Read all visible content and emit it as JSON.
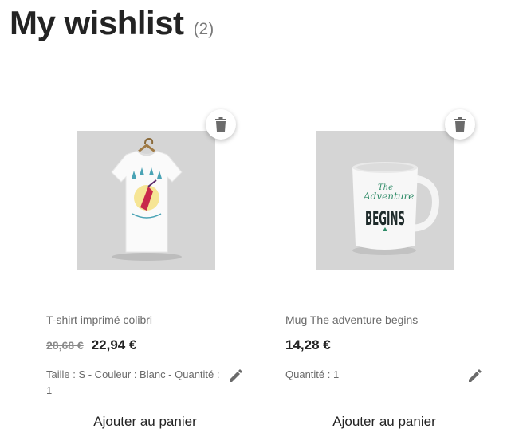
{
  "header": {
    "title": "My wishlist",
    "count": "(2)"
  },
  "products": [
    {
      "name": "T-shirt imprimé colibri",
      "old_price": "28,68 €",
      "price": "22,94 €",
      "attributes": "Taille : S - Couleur : Blanc - Quantité : 1",
      "add_to_cart_label": "Ajouter au panier",
      "image": "tshirt-hummingbird-image"
    },
    {
      "name": "Mug The adventure begins",
      "price": "14,28 €",
      "attributes": "Quantité : 1",
      "add_to_cart_label": "Ajouter au panier",
      "image": "mug-adventure-begins-image",
      "mug_text_top": "The",
      "mug_text_mid": "Adventure",
      "mug_text_bottom": "BEGINS"
    }
  ],
  "icons": {
    "delete": "trash-icon",
    "edit": "pencil-icon"
  },
  "colors": {
    "text_dark": "#232323",
    "text_muted": "#6a6a6a",
    "image_bg": "#d5d5d5",
    "mug_accent": "#2e8b67"
  }
}
